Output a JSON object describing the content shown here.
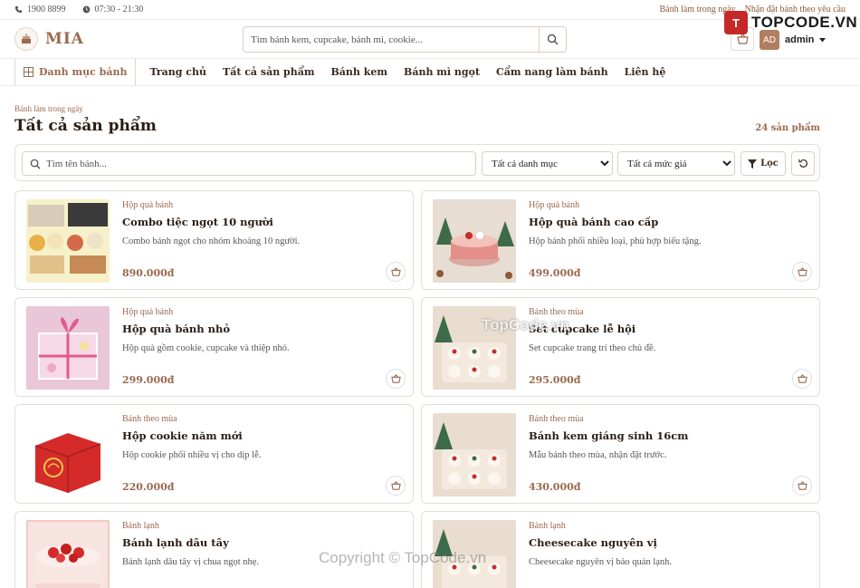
{
  "topbar": {
    "phone": "1900 8899",
    "hours": "07:30 - 21:30",
    "link_daily": "Bánh làm trong ngày",
    "link_order": "Nhận đặt bánh theo yêu cầu"
  },
  "header": {
    "logo": "MIA",
    "search_placeholder": "Tìm bánh kem, cupcake, bánh mì, cookie...",
    "avatar": "AD",
    "user": "admin"
  },
  "watermark": {
    "logo_text": "TOPCODE.VN",
    "logo_letter": "T",
    "center": "TopCode.vn",
    "copyright": "Copyright © TopCode.vn"
  },
  "nav": {
    "category": "Danh mục bánh",
    "items": [
      "Trang chủ",
      "Tất cả sản phẩm",
      "Bánh kem",
      "Bánh mì ngọt",
      "Cẩm nang làm bánh",
      "Liên hệ"
    ]
  },
  "page": {
    "breadcrumb": "Bánh làm trong ngày",
    "title": "Tất cả sản phẩm",
    "count": "24 sản phẩm"
  },
  "filter": {
    "search_placeholder": "Tìm tên bánh...",
    "category_selected": "Tất cả danh mục",
    "price_selected": "Tất cả mức giá",
    "filter_label": "Lọc"
  },
  "products": [
    {
      "category": "Hộp quà bánh",
      "name": "Combo tiệc ngọt 10 người",
      "desc": "Combo bánh ngọt cho nhóm khoảng 10 người.",
      "price": "890.000đ"
    },
    {
      "category": "Hộp quà bánh",
      "name": "Hộp quà bánh cao cấp",
      "desc": "Hộp bánh phối nhiều loại, phù hợp biếu tặng.",
      "price": "499.000đ"
    },
    {
      "category": "Hộp quà bánh",
      "name": "Hộp quà bánh nhỏ",
      "desc": "Hộp quà gồm cookie, cupcake và thiệp nhỏ.",
      "price": "299.000đ"
    },
    {
      "category": "Bánh theo mùa",
      "name": "Set cupcake lễ hội",
      "desc": "Set cupcake trang trí theo chủ đề.",
      "price": "295.000đ"
    },
    {
      "category": "Bánh theo mùa",
      "name": "Hộp cookie năm mới",
      "desc": "Hộp cookie phối nhiều vị cho dịp lễ.",
      "price": "220.000đ"
    },
    {
      "category": "Bánh theo mùa",
      "name": "Bánh kem giáng sinh 16cm",
      "desc": "Mẫu bánh theo mùa, nhận đặt trước.",
      "price": "430.000đ"
    },
    {
      "category": "Bánh lạnh",
      "name": "Bánh lạnh dâu tây",
      "desc": "Bánh lạnh dâu tây vị chua ngọt nhẹ.",
      "price": ""
    },
    {
      "category": "Bánh lạnh",
      "name": "Cheesecake nguyên vị",
      "desc": "Cheesecake nguyên vị bảo quản lạnh.",
      "price": ""
    }
  ],
  "colors": {
    "accent": "#9b6a4e",
    "border": "#e6ddd5",
    "text": "#2a1d15"
  }
}
